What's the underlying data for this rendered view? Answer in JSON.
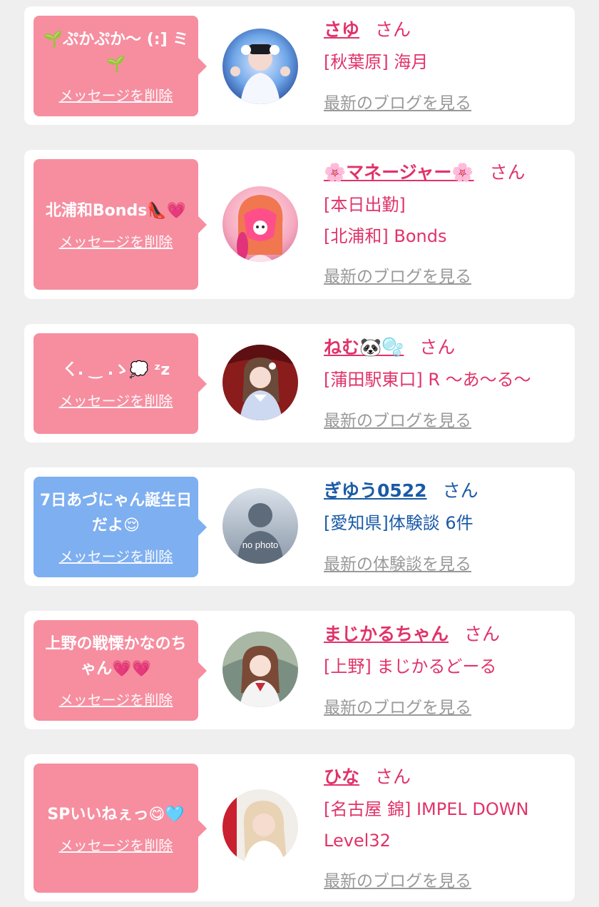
{
  "colors": {
    "accent_pink": "#e0336a",
    "accent_blue": "#1a5aa6",
    "bubble_pink": "#f68ea0",
    "bubble_blue": "#7eaff0",
    "link_gray": "#999999"
  },
  "delete_label": "メッセージを削除",
  "honorific": "さん",
  "entries": [
    {
      "message": "🌱ぷかぷか〜 (:] ミ🌱",
      "name": "さゆ",
      "lines": [
        "[秋葉原] 海月"
      ],
      "link": "最新のブログを見る",
      "bubble": "pink"
    },
    {
      "message": "北浦和Bonds👠💗",
      "name": "🌸マネージャー🌸",
      "lines": [
        "[本日出勤]",
        "[北浦和] Bonds"
      ],
      "link": "最新のブログを見る",
      "bubble": "pink"
    },
    {
      "message": "ㄑ. ‿ .ゝ💭 ᶻz",
      "name": "ねむ🐼🫧",
      "lines": [
        "[蒲田駅東口] R 〜あ〜る〜"
      ],
      "link": "最新のブログを見る",
      "bubble": "pink"
    },
    {
      "message": "7日あづにゃん誕生日だよ😌",
      "name": "ぎゆう0522",
      "lines": [
        "[愛知県]体験談 6件"
      ],
      "link": "最新の体験談を見る",
      "bubble": "blue",
      "avatar_text": "no photo"
    },
    {
      "message": "上野の戦慄かなのちゃん💗💗",
      "name": "まじかるちゃん",
      "lines": [
        "[上野] まじかるどーる"
      ],
      "link": "最新のブログを見る",
      "bubble": "pink"
    },
    {
      "message": "SPいいねぇっ😋🩵",
      "name": "ひな",
      "lines": [
        "[名古屋 錦] IMPEL DOWN",
        "Level32"
      ],
      "link": "最新のブログを見る",
      "bubble": "pink"
    }
  ]
}
